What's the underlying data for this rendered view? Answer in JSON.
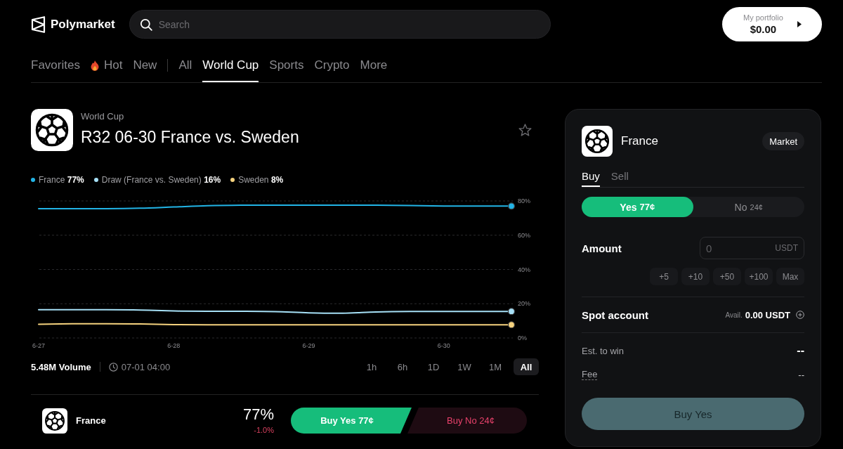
{
  "header": {
    "logo": "Polymarket",
    "search": {
      "placeholder": "Search"
    },
    "portfolio": {
      "label": "My portfolio",
      "value": "$0.00"
    }
  },
  "nav": {
    "groups": [
      [
        {
          "label": "Favorites",
          "kind": "text",
          "selected": false
        },
        {
          "label": "Hot",
          "kind": "icon",
          "selected": false
        },
        {
          "label": "New",
          "kind": "text",
          "selected": false
        }
      ],
      [
        {
          "label": "All",
          "kind": "text",
          "selected": false
        },
        {
          "label": "World Cup",
          "kind": "text",
          "selected": true
        },
        {
          "label": "Sports",
          "kind": "text",
          "selected": false
        },
        {
          "label": "Crypto",
          "kind": "text",
          "selected": false
        },
        {
          "label": "More",
          "kind": "text",
          "selected": false
        }
      ]
    ]
  },
  "event": {
    "category": "World Cup",
    "title": "R32 06-30 France vs. Sweden",
    "starred": false,
    "legend_values": [
      "77%",
      "16%",
      "8%"
    ],
    "chart_data": {
      "type": "line",
      "grid": true,
      "categories": [
        "6-27",
        null,
        null,
        null,
        "6-28",
        null,
        null,
        null,
        "6-29",
        null,
        null,
        null,
        "6-30",
        null,
        null
      ],
      "ylim": [
        0,
        80
      ],
      "yticks": [
        {
          "value": 0,
          "label": "0%"
        },
        {
          "value": 20,
          "label": "20%"
        },
        {
          "value": 40,
          "label": "40%"
        },
        {
          "value": 60,
          "label": "60%"
        },
        {
          "value": 80,
          "label": "80%"
        }
      ],
      "series": [
        {
          "name": "France",
          "color": "#22b4e6",
          "values": [
            75.5,
            75.5,
            75.5,
            75.8,
            76.5,
            77.2,
            77.5,
            77.5,
            77.5,
            77.5,
            77.5,
            77.3,
            77,
            77,
            77
          ]
        },
        {
          "name": "Draw (France vs. Sweden)",
          "color": "#a6e0f6",
          "values": [
            16.5,
            16.5,
            16.5,
            16.3,
            15.8,
            15.6,
            15.6,
            15.4,
            14.7,
            14.5,
            15.2,
            15.5,
            15.5,
            15.5,
            15.5
          ]
        },
        {
          "name": "Sweden",
          "color": "#f5d27e",
          "values": [
            8,
            8.3,
            8.3,
            8.2,
            7.8,
            7.7,
            7.7,
            7.7,
            7.7,
            7.7,
            7.7,
            7.7,
            7.7,
            7.7,
            7.7
          ]
        }
      ]
    },
    "volume": "5.48M Volume",
    "end_time": "07-01 04:00",
    "ranges": [
      {
        "label": "1h",
        "selected": false
      },
      {
        "label": "6h",
        "selected": false
      },
      {
        "label": "1D",
        "selected": false
      },
      {
        "label": "1W",
        "selected": false
      },
      {
        "label": "1M",
        "selected": false
      },
      {
        "label": "All",
        "selected": true
      }
    ]
  },
  "outcomes": [
    {
      "name": "France",
      "probability": "77%",
      "change": "-1.0%",
      "buy_yes": "Buy Yes 77¢",
      "buy_no": "Buy No 24¢"
    }
  ],
  "trade": {
    "outcome": "France",
    "order_type": "Market",
    "sides": [
      {
        "label": "Buy",
        "selected": true
      },
      {
        "label": "Sell",
        "selected": false
      }
    ],
    "choices": [
      {
        "label": "Yes",
        "price": "77¢",
        "selected": true
      },
      {
        "label": "No",
        "price": "24¢",
        "selected": false
      }
    ],
    "amount": {
      "label": "Amount",
      "placeholder": "0",
      "unit": "USDT"
    },
    "quick_amounts": [
      "+5",
      "+10",
      "+50",
      "+100",
      "Max"
    ],
    "account": {
      "label": "Spot account",
      "avail_label": "Avail.",
      "balance": "0.00 USDT"
    },
    "summary": [
      {
        "label": "Est. to win",
        "value": "--",
        "kind": "plain"
      },
      {
        "label": "Fee",
        "value": "--",
        "kind": "hint"
      }
    ],
    "submit": {
      "label": "Buy Yes",
      "disabled": true
    }
  }
}
